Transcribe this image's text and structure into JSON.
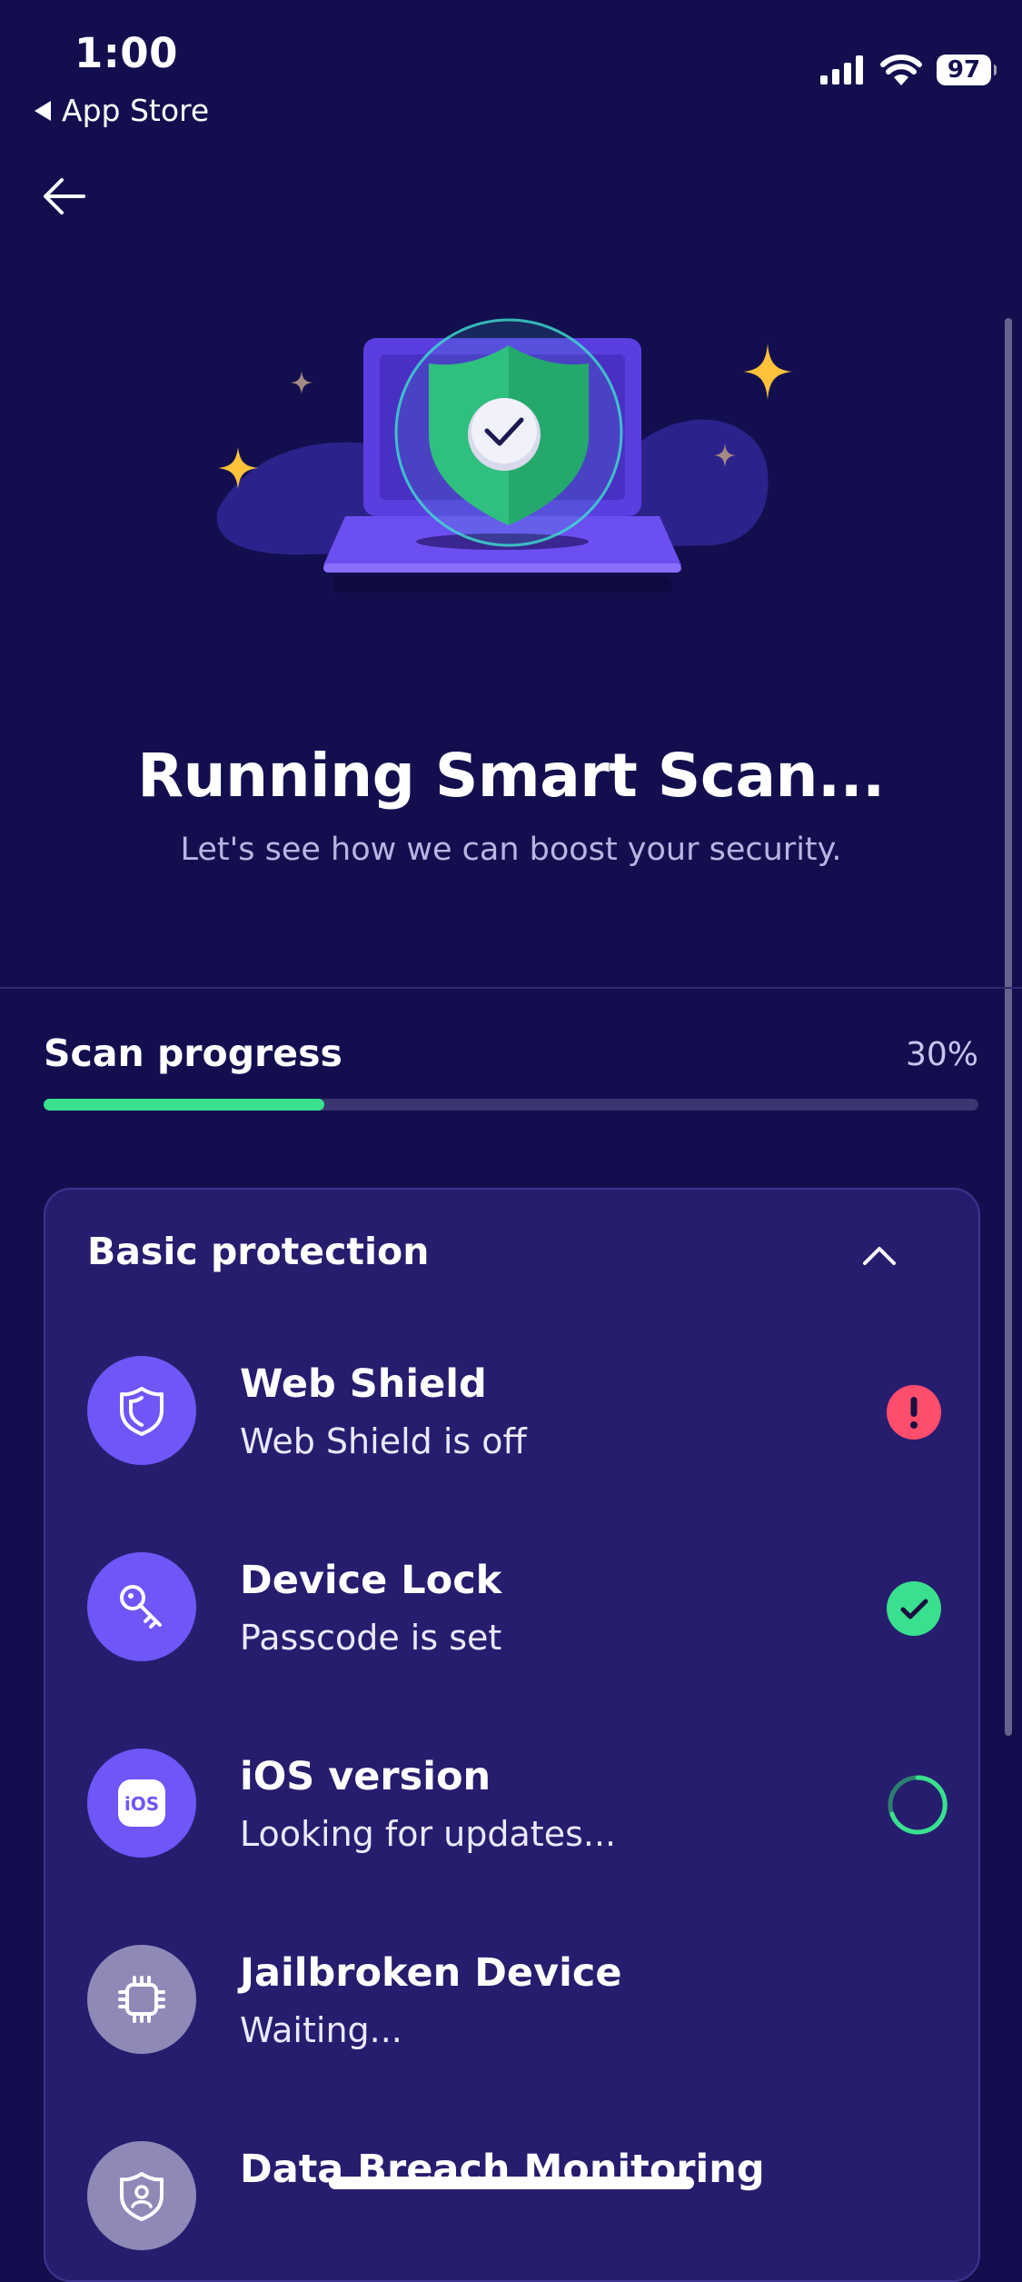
{
  "status_bar": {
    "time": "1:00",
    "back_app": "App Store",
    "battery": "97"
  },
  "header": {
    "back_icon": "arrow-left-icon"
  },
  "hero": {
    "title": "Running Smart Scan...",
    "subtitle": "Let's see how we can boost your security."
  },
  "progress": {
    "label": "Scan progress",
    "value_text": "30%",
    "value": 0.3,
    "color": "#39e08f"
  },
  "card": {
    "title": "Basic protection",
    "items": [
      {
        "title": "Web Shield",
        "subtitle": "Web Shield is off",
        "icon": "shield-icon",
        "status": "warning",
        "status_color": "#ff4d6d"
      },
      {
        "title": "Device Lock",
        "subtitle": "Passcode is set",
        "icon": "key-icon",
        "status": "ok",
        "status_color": "#39e08f"
      },
      {
        "title": "iOS version",
        "subtitle": "Looking for updates...",
        "icon": "ios-icon",
        "status": "loading",
        "status_color": "#39e08f"
      },
      {
        "title": "Jailbroken Device",
        "subtitle": "Waiting...",
        "icon": "chip-icon",
        "status": "waiting"
      },
      {
        "title": "Data Breach Monitoring",
        "subtitle": "",
        "icon": "user-shield-icon",
        "status": "waiting"
      }
    ]
  },
  "colors": {
    "background": "#130f4f",
    "card": "#271d6e",
    "accent": "#6f56f7"
  }
}
